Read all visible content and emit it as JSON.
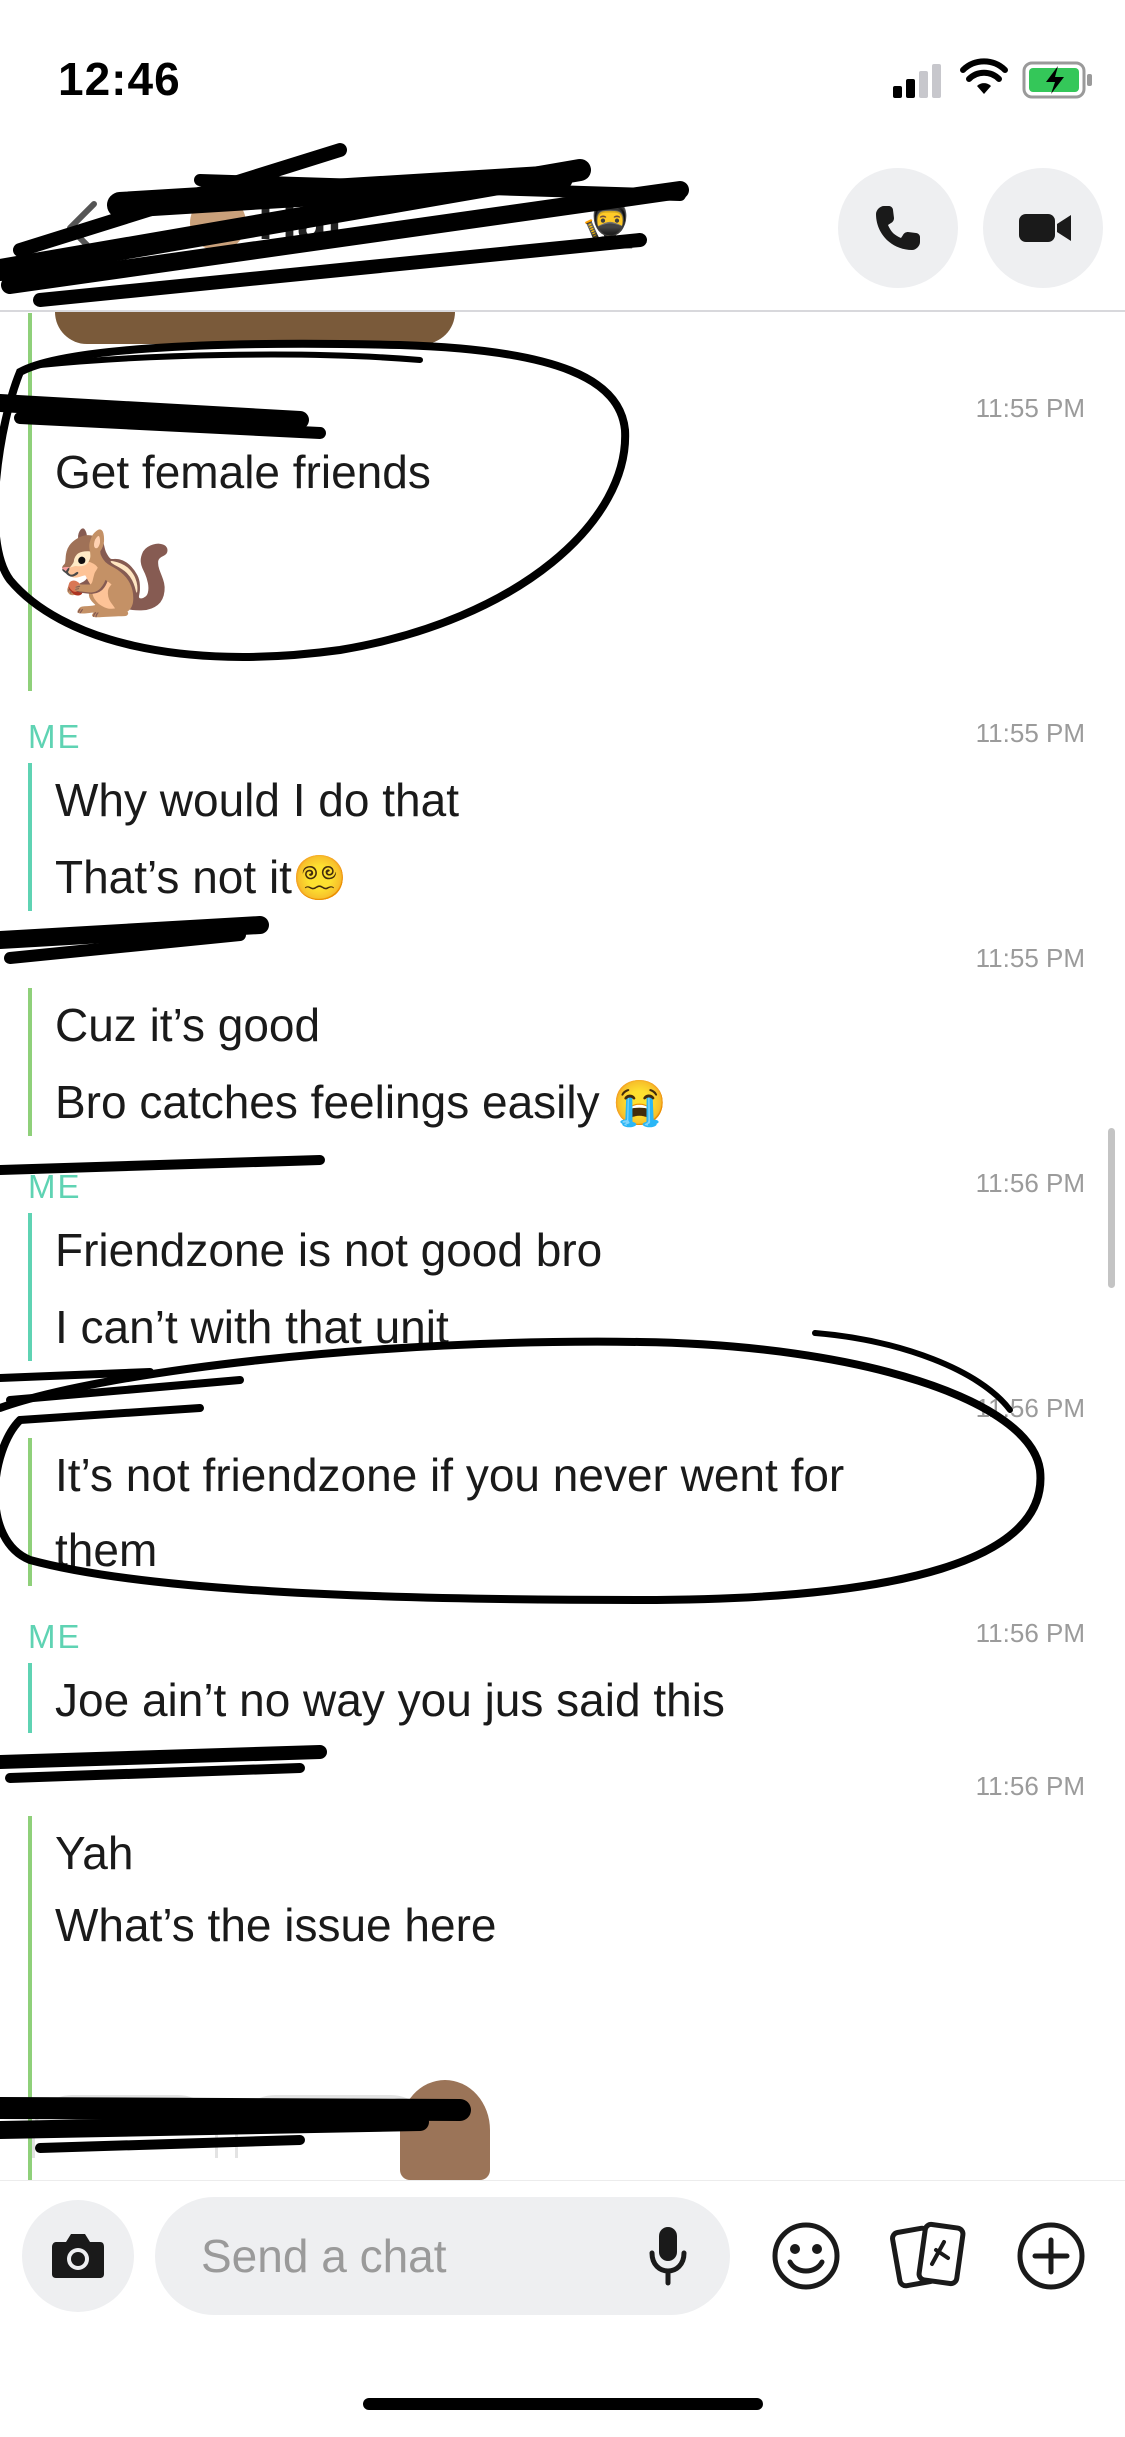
{
  "status_bar": {
    "time": "12:46"
  },
  "header": {
    "friend_name": "Hal"
  },
  "messages": [
    {
      "sender": "",
      "time": "11:55 PM",
      "lines": [
        "Get female friends"
      ]
    },
    {
      "sender": "ME",
      "time": "11:55 PM",
      "lines": [
        "Why would I do that",
        "That’s not it"
      ]
    },
    {
      "sender": "",
      "time": "11:55 PM",
      "lines": [
        "Cuz it’s good",
        "Bro catches feelings easily"
      ]
    },
    {
      "sender": "ME",
      "time": "11:56 PM",
      "lines": [
        "Friendzone is not good bro",
        "I can’t with that unit"
      ]
    },
    {
      "sender": "",
      "time": "11:56 PM",
      "lines": [
        "It’s not friendzone if you never went for",
        "them"
      ]
    },
    {
      "sender": "ME",
      "time": "11:56 PM",
      "lines": [
        "Joe ain’t no way you jus said this"
      ]
    },
    {
      "sender": "",
      "time": "11:56 PM",
      "lines": [
        "Yah",
        "What’s the issue here"
      ]
    }
  ],
  "composer": {
    "placeholder": "Send a chat"
  },
  "colors": {
    "me": "#5fd3b3",
    "friend": "#8fd07a",
    "button_bg": "#eeeff1",
    "battery_green": "#34c759"
  },
  "icons": [
    "back-icon",
    "phone-icon",
    "video-icon",
    "camera-icon",
    "mic-icon",
    "smile-icon",
    "cards-icon",
    "plus-icon"
  ]
}
